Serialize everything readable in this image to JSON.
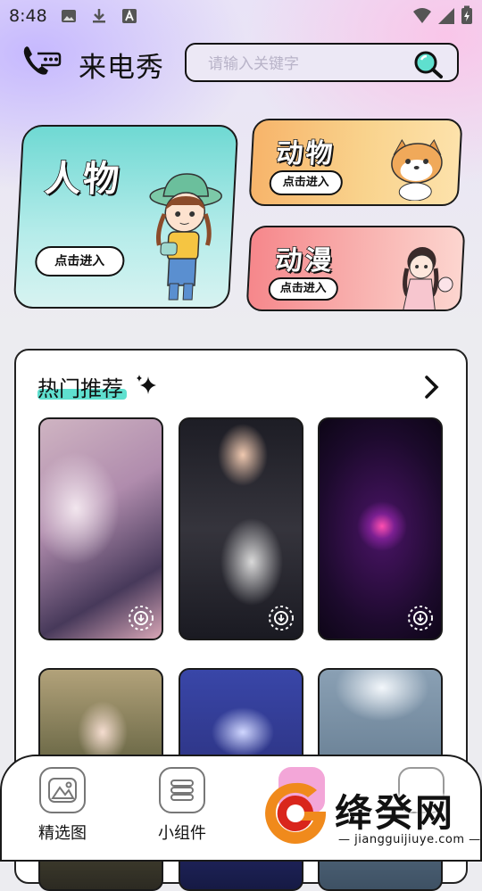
{
  "status_bar": {
    "time": "8:48",
    "left_icons": [
      "image-icon",
      "download-icon",
      "font-app-icon"
    ],
    "right_icons": [
      "wifi-icon",
      "signal-icon",
      "battery-charging-icon"
    ]
  },
  "header": {
    "title": "来电秀",
    "search_placeholder": "请输入关键字",
    "search_value": ""
  },
  "categories": {
    "people": {
      "title": "人物",
      "button": "点击进入"
    },
    "animal": {
      "title": "动物",
      "button": "点击进入"
    },
    "anime": {
      "title": "动漫",
      "button": "点击进入"
    }
  },
  "hot": {
    "title": "热门推荐",
    "thumbnails": 6
  },
  "nav": {
    "items": [
      {
        "label": "精选图",
        "icon": "gallery-icon"
      },
      {
        "label": "小组件",
        "icon": "widget-icon"
      }
    ]
  },
  "watermark": {
    "text": "绛癸网",
    "url": "jiangguijiuye.com"
  },
  "colors": {
    "accent_teal": "#5fe0cf",
    "people_card": "#6fd9d3",
    "animal_card": "#f7b46a",
    "anime_card": "#f6878b",
    "watermark_orange": "#f08a1c",
    "watermark_red": "#d9261c"
  }
}
